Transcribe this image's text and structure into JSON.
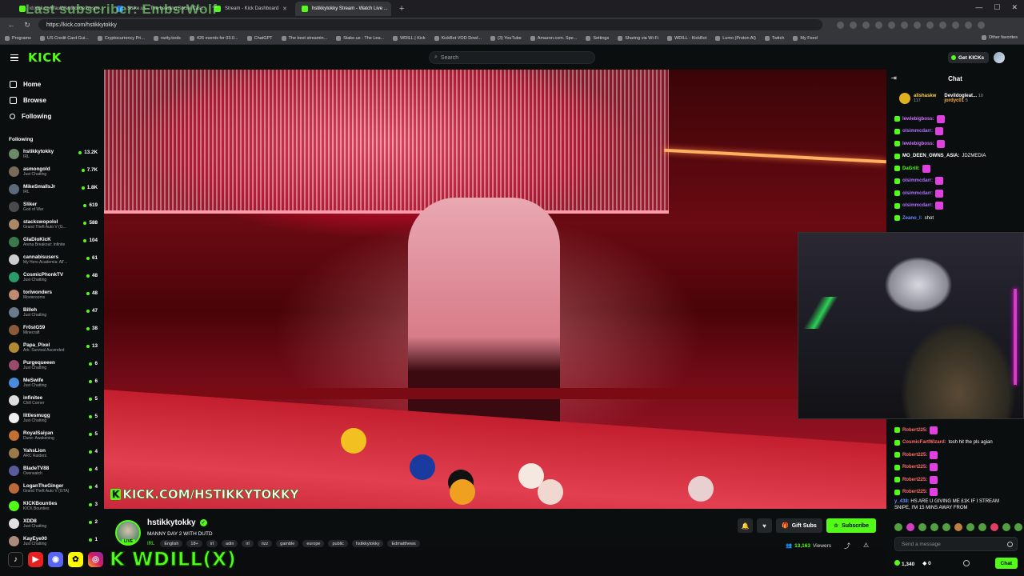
{
  "browser": {
    "tabs": [
      {
        "label": "id.kick.com/auth/authorize?respo..."
      },
      {
        "label": "Stake.us - The Leading Social Cas..."
      },
      {
        "label": "Stream - Kick Dashboard"
      },
      {
        "label": "hstikkytokky Stream - Watch Live ..."
      }
    ],
    "url": "https://kick.com/hstikkytokky",
    "bookmarks": [
      "Programs",
      "US Credit Card Gui...",
      "Cryptocurrency Pri...",
      "rarity.tools",
      "426 events for 03.0...",
      "ChatGPT",
      "The best streamin...",
      "Stake.us - The Lea...",
      "WDILL | Kick",
      "KickBot VOD Dowl...",
      "(3) YouTube",
      "Amazon.com. Spe...",
      "Settings",
      "Sharing via Wi-Fi",
      "WDILL - KickBot",
      "Lumo (Proton AI)",
      "Twitch",
      "My Feed"
    ],
    "other_favorites": "Other favorites"
  },
  "overlay": {
    "last_subscriber": "Last subscriber: EmbsrWolf"
  },
  "topbar": {
    "logo": "KICK",
    "search_placeholder": "Search",
    "get_kicks": "Get KICKs"
  },
  "sidebar": {
    "nav": [
      {
        "label": "Home",
        "icon": "home-icon"
      },
      {
        "label": "Browse",
        "icon": "browse-icon"
      },
      {
        "label": "Following",
        "icon": "heart-icon"
      }
    ],
    "following_header": "Following",
    "channels": [
      {
        "name": "hstikkytokky",
        "category": "IRL",
        "viewers": "13.2K",
        "color": "#6a8a6a"
      },
      {
        "name": "asmongold",
        "category": "Just Chatting",
        "viewers": "7.7K",
        "color": "#7a6a5a"
      },
      {
        "name": "MikeSmallsJr",
        "category": "IRL",
        "viewers": "1.8K",
        "color": "#5a6a7a"
      },
      {
        "name": "Sliker",
        "category": "God of War",
        "viewers": "619",
        "color": "#4a4a4a"
      },
      {
        "name": "stackswopolol",
        "category": "Grand Theft Auto V (G...",
        "viewers": "588",
        "color": "#aa8866"
      },
      {
        "name": "GlaDioKicK",
        "category": "Arena Breakout: Infinite",
        "viewers": "104",
        "color": "#3a7a4a"
      },
      {
        "name": "cannabisusers",
        "category": "My Hero Academia: All'...",
        "viewers": "61",
        "color": "#cccccc"
      },
      {
        "name": "CosmicPhonkTV",
        "category": "Just Chatting",
        "viewers": "48",
        "color": "#2a9a6a"
      },
      {
        "name": "toriwonders",
        "category": "Movierooms",
        "viewers": "48",
        "color": "#c08a70"
      },
      {
        "name": "Billeh",
        "category": "Just Chatting",
        "viewers": "47",
        "color": "#6a7a8a"
      },
      {
        "name": "Fr0stG59",
        "category": "Minecraft",
        "viewers": "38",
        "color": "#8a5a3a"
      },
      {
        "name": "Papa_Pixel",
        "category": "Ark: Survival Ascended",
        "viewers": "13",
        "color": "#b08a30"
      },
      {
        "name": "Purgequeeen",
        "category": "Just Chatting",
        "viewers": "6",
        "color": "#9a4a6a"
      },
      {
        "name": "MeSwife",
        "category": "Just Chatting",
        "viewers": "6",
        "color": "#4a8ada"
      },
      {
        "name": "infinitee",
        "category": "Chill Corner",
        "viewers": "5",
        "color": "#dddddd"
      },
      {
        "name": "littlesmugg",
        "category": "Just Chatting",
        "viewers": "5",
        "color": "#eeeeee"
      },
      {
        "name": "RoyalSaiyan",
        "category": "Dune: Awakening",
        "viewers": "5",
        "color": "#c07030"
      },
      {
        "name": "YahsLion",
        "category": "ARC Raiders",
        "viewers": "4",
        "color": "#9a7a4a"
      },
      {
        "name": "BladeTV88",
        "category": "Overwatch",
        "viewers": "4",
        "color": "#5a5a9a"
      },
      {
        "name": "LoganTheGinger",
        "category": "Grand Theft Auto V (GTA)",
        "viewers": "4",
        "color": "#ba6a3a"
      },
      {
        "name": "KICKBounties",
        "category": "KICK Bounties",
        "viewers": "3",
        "color": "#53fc18"
      },
      {
        "name": "XDD8",
        "category": "Just Chatting",
        "viewers": "2",
        "color": "#e0e0e0"
      },
      {
        "name": "KayEye00",
        "category": "Just Chatting",
        "viewers": "1",
        "color": "#aa8a7a"
      }
    ]
  },
  "video": {
    "watermark": "KICK.COM/HSTIKKYTOKKY"
  },
  "socials": {
    "brand": "WDILL(X)"
  },
  "stream": {
    "streamer": "hstikkytokky",
    "title": "MANNY DAY 2 WITH DUTD",
    "category": "IRL",
    "tags": [
      "English",
      "18+",
      "irl",
      "adin",
      "irl",
      "rizz",
      "gamble",
      "europe",
      "public",
      "hstikkytokky",
      "Edmatthews"
    ],
    "gift_subs": "Gift Subs",
    "subscribe": "Subscribe",
    "viewers": "13,163",
    "viewers_label": "Viewers"
  },
  "chat": {
    "title": "Chat",
    "leaderboard": [
      {
        "name": "alishaskw",
        "sub": "117"
      },
      {
        "name": "Devildogleat...",
        "sub": "10"
      },
      {
        "name": "jordyc01",
        "sub": "5"
      }
    ],
    "messages_top": [
      {
        "user": "lewiebigboss:",
        "text": "",
        "color": "#d070ff",
        "emote": true
      },
      {
        "user": "olsimmcdarr:",
        "text": "",
        "color": "#b070ff",
        "emote": true
      },
      {
        "user": "lewiebigboss:",
        "text": "",
        "color": "#d070ff",
        "emote": true
      },
      {
        "user": "MO_DEEN_OWNS_ASIA:",
        "text": "JDZMEDIA",
        "color": "#ffffff",
        "emote": false
      },
      {
        "user": "DaGrill:",
        "text": "",
        "color": "#53fc18",
        "emote": true
      },
      {
        "user": "olsimmcdarr:",
        "text": "",
        "color": "#b070ff",
        "emote": true
      },
      {
        "user": "olsimmcdarr:",
        "text": "",
        "color": "#b070ff",
        "emote": true
      },
      {
        "user": "olsimmcdarr:",
        "text": "",
        "color": "#b070ff",
        "emote": true
      },
      {
        "user": "Zeano_l:",
        "text": "shot",
        "color": "#6a8aff",
        "emote": false
      }
    ],
    "messages_bottom": [
      {
        "user": "Robert225:",
        "text": "",
        "color": "#ff6a6a",
        "emote": true
      },
      {
        "user": "CosmicFartWizard:",
        "text": "tosh hit the pls agian",
        "color": "#ff6a6a",
        "emote": false
      },
      {
        "user": "Robert225:",
        "text": "",
        "color": "#ff6a6a",
        "emote": true
      },
      {
        "user": "Robert225:",
        "text": "",
        "color": "#ff6a6a",
        "emote": true
      },
      {
        "user": "Robert225:",
        "text": "",
        "color": "#ff6a6a",
        "emote": true
      },
      {
        "user": "Robert225:",
        "text": "",
        "color": "#ff6a6a",
        "emote": true
      }
    ],
    "long_message": {
      "user": "y_438:",
      "text": "HS ARE U GIVING ME £1K IF I STREAM SNIPE, I'M 15 MINS AWAY FROM"
    },
    "input_placeholder": "Send a message",
    "points": "1,340",
    "points2": "0",
    "chat_button": "Chat"
  },
  "colors": {
    "accent": "#53fc18",
    "background": "#0b0e0f"
  }
}
